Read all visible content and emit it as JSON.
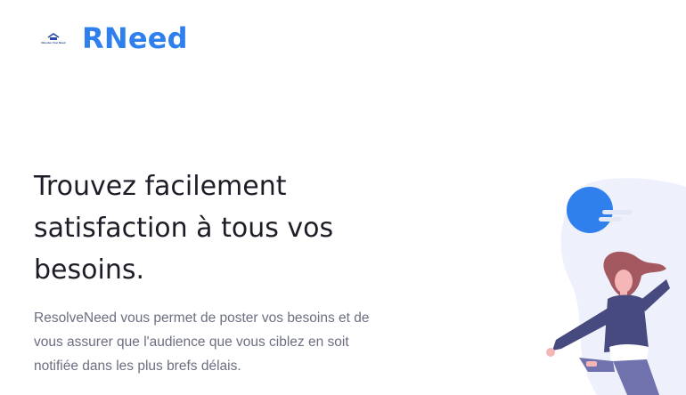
{
  "header": {
    "logo_small_text": "Résolve Your Need",
    "brand_name": "RNeed"
  },
  "hero": {
    "title_line1": "Trouvez facilement",
    "title_line2": "satisfaction à tous vos",
    "title_line3": "besoins.",
    "description_line1": "ResolveNeed vous permet de poster vos besoins et de",
    "description_line2": "vous assurer que l'audience que vous ciblez en soit",
    "description_line3": "notifiée dans les plus brefs délais."
  },
  "colors": {
    "brand": "#2f80ed",
    "title": "#1d1d28",
    "text": "#6b6f80",
    "illustration_bg": "#eef1fb",
    "hair": "#a4585f",
    "sweater": "#474a7e"
  },
  "icons": {
    "logo": "house-logo-icon",
    "illustration": "woman-jumping-illustration"
  }
}
